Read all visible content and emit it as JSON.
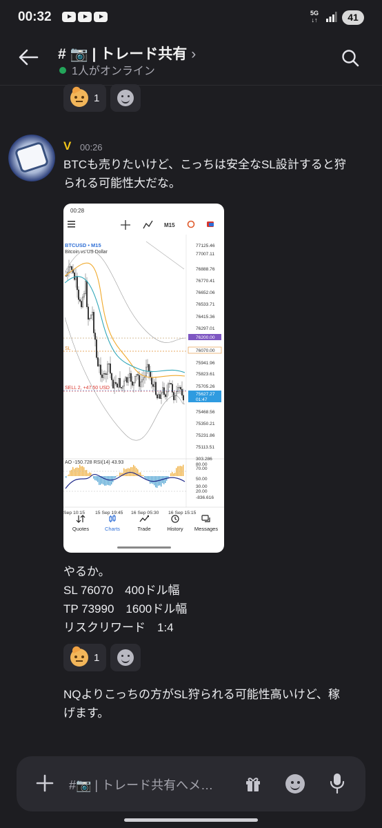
{
  "status_bar": {
    "time": "00:32",
    "network": "5G",
    "battery": "41"
  },
  "header": {
    "channel_name": "# 📷 | トレード共有",
    "chevron": "›",
    "online_text": "1人がオンライン"
  },
  "reactions_top": {
    "count": "1"
  },
  "message": {
    "author": "V",
    "author_color": "#f0c419",
    "timestamp": "00:26",
    "text_1_line_1": "BTCも売りたいけど、こっちは安全なSL設計すると狩",
    "text_1_line_2": "られる可能性大だな。",
    "text_2_lines": [
      "やるか。",
      "SL 76070　400ドル幅",
      "TP 73990　1600ドル幅",
      "リスクリワード　1:4"
    ],
    "reaction_count": "1",
    "text_3_line_1": "NQよりこっちの方がSL狩られる可能性高いけど、稼",
    "text_3_line_2": "げます。"
  },
  "embedded_screenshot": {
    "status_time": "00:28",
    "timeframe": "M15",
    "symbol": "BTCUSD • M15",
    "symbol_desc": "Bitcoin vs US Dollar",
    "price_axis": [
      "77125.46",
      "77007.11",
      "76888.76",
      "76770.41",
      "76652.06",
      "76533.71",
      "76415.36",
      "76297.01",
      "76200.00",
      "76070.00",
      "75941.96",
      "75823.61",
      "75705.26",
      "75627.27",
      "01:47",
      "75468.56",
      "75350.21",
      "75231.86",
      "75113.51"
    ],
    "sl_label": "SL",
    "sell_label": "SELL 2, +47.50 USD",
    "indicator_label": "AO -150.728 RSI(14) 43.93",
    "indicator_axis": [
      "303.286",
      "80.00",
      "70.00",
      "50.00",
      "30.00",
      "20.00",
      "-836.616"
    ],
    "time_axis": [
      "Sep 10:15",
      "15 Sep 19:45",
      "16 Sep 05:30",
      "16 Sep 15:15"
    ],
    "nav": [
      "Quotes",
      "Charts",
      "Trade",
      "History",
      "Messages"
    ],
    "accent": "#2f6fd6"
  },
  "input": {
    "placeholder": "#📷 | トレード共有へメ…"
  }
}
